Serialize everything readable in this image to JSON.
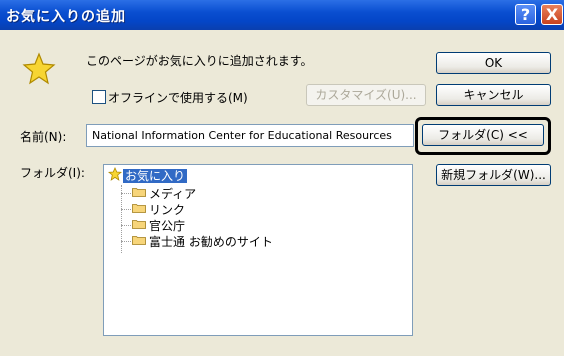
{
  "window": {
    "title": "お気に入りの追加",
    "help_label": "?",
    "close_label": "X"
  },
  "message": "このページがお気に入りに追加されます。",
  "offline_label": "オフラインで使用する(M)",
  "buttons": {
    "ok": "OK",
    "cancel": "キャンセル",
    "customize": "カスタマイズ(U)...",
    "folder": "フォルダ(C) <<",
    "new_folder": "新規フォルダ(W)..."
  },
  "name_label": "名前(N):",
  "name_value": "National Information Center for Educational Resources",
  "folder_label": "フォルダ(I):",
  "tree": {
    "root": "お気に入り",
    "children": [
      "メディア",
      "リンク",
      "官公庁",
      "富士通 お勧めのサイト"
    ]
  },
  "colors": {
    "title_bar": "#0a4fd1",
    "selection": "#316ac5",
    "dialog_bg": "#ece9d8",
    "highlight_frame": "#000000"
  },
  "icons": {
    "star": "favorites-star-icon",
    "folder": "folder-icon"
  }
}
